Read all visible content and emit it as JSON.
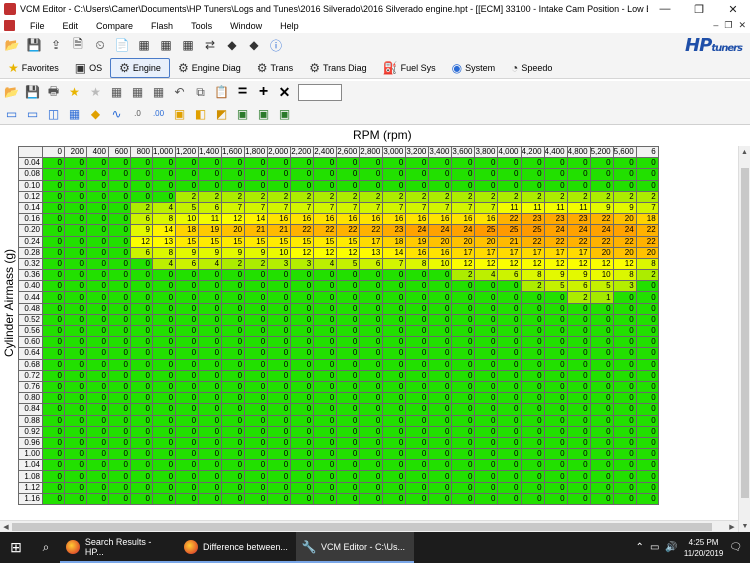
{
  "window": {
    "title": "VCM Editor - C:\\Users\\Camer\\Documents\\HP Tuners\\Logs and Tunes\\2016 Silverado\\2016 Silverado engine.hpt - [[ECM] 33100 - Intake Cam Position - Low Baro]"
  },
  "menu": [
    "File",
    "Edit",
    "Compare",
    "Flash",
    "Tools",
    "Window",
    "Help"
  ],
  "logo": {
    "main": "HP",
    "sub": "tuners"
  },
  "nav_tabs": [
    {
      "label": "Favorites",
      "icon": "star-icon"
    },
    {
      "label": "OS",
      "icon": "chip-icon"
    },
    {
      "label": "Engine",
      "icon": "engine-icon",
      "active": true
    },
    {
      "label": "Engine Diag",
      "icon": "engine-diag-icon"
    },
    {
      "label": "Trans",
      "icon": "gear-icon"
    },
    {
      "label": "Trans Diag",
      "icon": "trans-diag-icon"
    },
    {
      "label": "Fuel Sys",
      "icon": "fuel-icon"
    },
    {
      "label": "System",
      "icon": "system-icon"
    },
    {
      "label": "Speedo",
      "icon": "speedometer-icon"
    }
  ],
  "table": {
    "x_axis_title": "RPM (rpm)",
    "y_axis_title": "Cylinder Airmass (g)",
    "columns": [
      "0",
      "200",
      "400",
      "600",
      "800",
      "1,000",
      "1,200",
      "1,400",
      "1,600",
      "1,800",
      "2,000",
      "2,200",
      "2,400",
      "2,600",
      "2,800",
      "3,000",
      "3,200",
      "3,400",
      "3,600",
      "3,800",
      "4,000",
      "4,200",
      "4,400",
      "4,800",
      "5,200",
      "5,600",
      "6"
    ],
    "rows": [
      "0.04",
      "0.08",
      "0.10",
      "0.12",
      "0.14",
      "0.16",
      "0.20",
      "0.24",
      "0.28",
      "0.32",
      "0.36",
      "0.40",
      "0.44",
      "0.48",
      "0.52",
      "0.56",
      "0.60",
      "0.64",
      "0.68",
      "0.72",
      "0.76",
      "0.80",
      "0.84",
      "0.88",
      "0.92",
      "0.96",
      "1.00",
      "1.04",
      "1.08",
      "1.12",
      "1.16"
    ],
    "values": [
      [
        0,
        0,
        0,
        0,
        0,
        0,
        0,
        0,
        0,
        0,
        0,
        0,
        0,
        0,
        0,
        0,
        0,
        0,
        0,
        0,
        0,
        0,
        0,
        0,
        0,
        0,
        0
      ],
      [
        0,
        0,
        0,
        0,
        0,
        0,
        0,
        0,
        0,
        0,
        0,
        0,
        0,
        0,
        0,
        0,
        0,
        0,
        0,
        0,
        0,
        0,
        0,
        0,
        0,
        0,
        0
      ],
      [
        0,
        0,
        0,
        0,
        0,
        0,
        0,
        0,
        0,
        0,
        0,
        0,
        0,
        0,
        0,
        0,
        0,
        0,
        0,
        0,
        0,
        0,
        0,
        0,
        0,
        0,
        0
      ],
      [
        0,
        0,
        0,
        0,
        0,
        0,
        2,
        2,
        2,
        2,
        2,
        2,
        2,
        2,
        2,
        2,
        2,
        2,
        2,
        2,
        2,
        2,
        2,
        2,
        2,
        2,
        2
      ],
      [
        0,
        0,
        0,
        0,
        2,
        4,
        5,
        6,
        7,
        7,
        7,
        7,
        7,
        7,
        7,
        7,
        7,
        7,
        7,
        7,
        11,
        11,
        11,
        11,
        9,
        9,
        7
      ],
      [
        0,
        0,
        0,
        0,
        6,
        8,
        10,
        11,
        12,
        14,
        16,
        16,
        16,
        16,
        16,
        16,
        16,
        16,
        16,
        16,
        22,
        23,
        23,
        23,
        22,
        20,
        18
      ],
      [
        0,
        0,
        0,
        0,
        9,
        14,
        18,
        19,
        20,
        21,
        21,
        22,
        22,
        22,
        22,
        23,
        24,
        24,
        24,
        25,
        25,
        25,
        24,
        24,
        24,
        24,
        22
      ],
      [
        0,
        0,
        0,
        0,
        12,
        13,
        15,
        15,
        15,
        15,
        15,
        15,
        15,
        15,
        17,
        18,
        19,
        20,
        20,
        20,
        21,
        22,
        22,
        22,
        22,
        22,
        22
      ],
      [
        0,
        0,
        0,
        0,
        6,
        8,
        9,
        9,
        9,
        9,
        10,
        12,
        12,
        12,
        13,
        14,
        16,
        16,
        17,
        17,
        17,
        17,
        17,
        17,
        20,
        20,
        20
      ],
      [
        0,
        0,
        0,
        0,
        0,
        4,
        6,
        4,
        2,
        2,
        3,
        3,
        4,
        5,
        6,
        7,
        8,
        10,
        12,
        12,
        12,
        12,
        12,
        12,
        12,
        12,
        8
      ],
      [
        0,
        0,
        0,
        0,
        0,
        0,
        0,
        0,
        0,
        0,
        0,
        0,
        0,
        0,
        0,
        0,
        0,
        0,
        2,
        4,
        6,
        8,
        9,
        9,
        10,
        8,
        2
      ],
      [
        0,
        0,
        0,
        0,
        0,
        0,
        0,
        0,
        0,
        0,
        0,
        0,
        0,
        0,
        0,
        0,
        0,
        0,
        0,
        0,
        0,
        2,
        5,
        6,
        5,
        3,
        0
      ],
      [
        0,
        0,
        0,
        0,
        0,
        0,
        0,
        0,
        0,
        0,
        0,
        0,
        0,
        0,
        0,
        0,
        0,
        0,
        0,
        0,
        0,
        0,
        0,
        2,
        1,
        0,
        0
      ],
      [
        0,
        0,
        0,
        0,
        0,
        0,
        0,
        0,
        0,
        0,
        0,
        0,
        0,
        0,
        0,
        0,
        0,
        0,
        0,
        0,
        0,
        0,
        0,
        0,
        0,
        0,
        0
      ],
      [
        0,
        0,
        0,
        0,
        0,
        0,
        0,
        0,
        0,
        0,
        0,
        0,
        0,
        0,
        0,
        0,
        0,
        0,
        0,
        0,
        0,
        0,
        0,
        0,
        0,
        0,
        0
      ],
      [
        0,
        0,
        0,
        0,
        0,
        0,
        0,
        0,
        0,
        0,
        0,
        0,
        0,
        0,
        0,
        0,
        0,
        0,
        0,
        0,
        0,
        0,
        0,
        0,
        0,
        0,
        0
      ],
      [
        0,
        0,
        0,
        0,
        0,
        0,
        0,
        0,
        0,
        0,
        0,
        0,
        0,
        0,
        0,
        0,
        0,
        0,
        0,
        0,
        0,
        0,
        0,
        0,
        0,
        0,
        0
      ],
      [
        0,
        0,
        0,
        0,
        0,
        0,
        0,
        0,
        0,
        0,
        0,
        0,
        0,
        0,
        0,
        0,
        0,
        0,
        0,
        0,
        0,
        0,
        0,
        0,
        0,
        0,
        0
      ],
      [
        0,
        0,
        0,
        0,
        0,
        0,
        0,
        0,
        0,
        0,
        0,
        0,
        0,
        0,
        0,
        0,
        0,
        0,
        0,
        0,
        0,
        0,
        0,
        0,
        0,
        0,
        0
      ],
      [
        0,
        0,
        0,
        0,
        0,
        0,
        0,
        0,
        0,
        0,
        0,
        0,
        0,
        0,
        0,
        0,
        0,
        0,
        0,
        0,
        0,
        0,
        0,
        0,
        0,
        0,
        0
      ],
      [
        0,
        0,
        0,
        0,
        0,
        0,
        0,
        0,
        0,
        0,
        0,
        0,
        0,
        0,
        0,
        0,
        0,
        0,
        0,
        0,
        0,
        0,
        0,
        0,
        0,
        0,
        0
      ],
      [
        0,
        0,
        0,
        0,
        0,
        0,
        0,
        0,
        0,
        0,
        0,
        0,
        0,
        0,
        0,
        0,
        0,
        0,
        0,
        0,
        0,
        0,
        0,
        0,
        0,
        0,
        0
      ],
      [
        0,
        0,
        0,
        0,
        0,
        0,
        0,
        0,
        0,
        0,
        0,
        0,
        0,
        0,
        0,
        0,
        0,
        0,
        0,
        0,
        0,
        0,
        0,
        0,
        0,
        0,
        0
      ],
      [
        0,
        0,
        0,
        0,
        0,
        0,
        0,
        0,
        0,
        0,
        0,
        0,
        0,
        0,
        0,
        0,
        0,
        0,
        0,
        0,
        0,
        0,
        0,
        0,
        0,
        0,
        0
      ],
      [
        0,
        0,
        0,
        0,
        0,
        0,
        0,
        0,
        0,
        0,
        0,
        0,
        0,
        0,
        0,
        0,
        0,
        0,
        0,
        0,
        0,
        0,
        0,
        0,
        0,
        0,
        0
      ],
      [
        0,
        0,
        0,
        0,
        0,
        0,
        0,
        0,
        0,
        0,
        0,
        0,
        0,
        0,
        0,
        0,
        0,
        0,
        0,
        0,
        0,
        0,
        0,
        0,
        0,
        0,
        0
      ],
      [
        0,
        0,
        0,
        0,
        0,
        0,
        0,
        0,
        0,
        0,
        0,
        0,
        0,
        0,
        0,
        0,
        0,
        0,
        0,
        0,
        0,
        0,
        0,
        0,
        0,
        0,
        0
      ],
      [
        0,
        0,
        0,
        0,
        0,
        0,
        0,
        0,
        0,
        0,
        0,
        0,
        0,
        0,
        0,
        0,
        0,
        0,
        0,
        0,
        0,
        0,
        0,
        0,
        0,
        0,
        0
      ],
      [
        0,
        0,
        0,
        0,
        0,
        0,
        0,
        0,
        0,
        0,
        0,
        0,
        0,
        0,
        0,
        0,
        0,
        0,
        0,
        0,
        0,
        0,
        0,
        0,
        0,
        0,
        0
      ],
      [
        0,
        0,
        0,
        0,
        0,
        0,
        0,
        0,
        0,
        0,
        0,
        0,
        0,
        0,
        0,
        0,
        0,
        0,
        0,
        0,
        0,
        0,
        0,
        0,
        0,
        0,
        0
      ],
      [
        0,
        0,
        0,
        0,
        0,
        0,
        0,
        0,
        0,
        0,
        0,
        0,
        0,
        0,
        0,
        0,
        0,
        0,
        0,
        0,
        0,
        0,
        0,
        0,
        0,
        0,
        0
      ]
    ],
    "colors": {
      "low": "#22e000",
      "mid": "#ffff00",
      "high": "#ff9a00"
    }
  },
  "taskbar": {
    "items": [
      {
        "label": "Search Results - HP...",
        "icon": "firefox-icon"
      },
      {
        "label": "Difference between...",
        "icon": "firefox-icon"
      },
      {
        "label": "VCM Editor - C:\\Us...",
        "icon": "vcm-editor-icon",
        "active": true
      }
    ],
    "time": "4:25 PM",
    "date": "11/20/2019"
  }
}
